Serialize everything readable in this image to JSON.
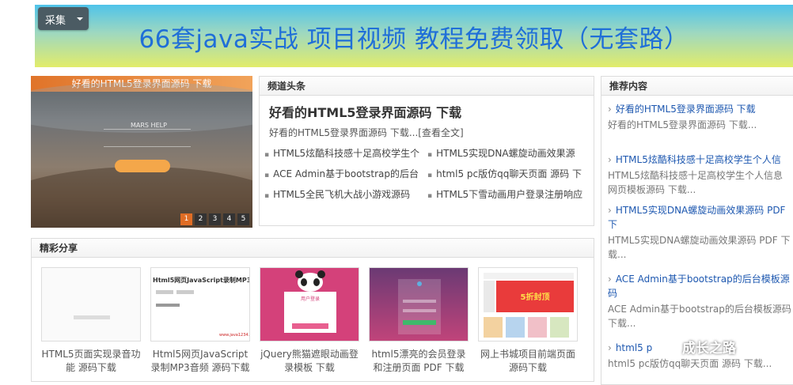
{
  "banner": {
    "title": "66套java实战 项目视频 教程免费领取（无套路）"
  },
  "collect": {
    "label": "采集"
  },
  "slider": {
    "title": "好看的HTML5登录界面源码 下载",
    "dots": [
      "1",
      "2",
      "3",
      "4",
      "5"
    ]
  },
  "channel": {
    "heading": "频道头条",
    "headline": "好看的HTML5登录界面源码 下载",
    "summary": "好看的HTML5登录界面源码 下载...",
    "more": "[查看全文]",
    "news": [
      "HTML5炫酷科技感十足高校学生个",
      "HTML5实现DNA螺旋动画效果源",
      "ACE Admin基于bootstrap的后台",
      "html5 pc版仿qq聊天页面 源码 下",
      "HTML5全民飞机大战小游戏源码",
      "HTML5下雪动画用户登录注册响应"
    ]
  },
  "share": {
    "heading": "精彩分享",
    "items": [
      {
        "caption": "HTML5页面实现录音功能 源码下载"
      },
      {
        "caption": "Html5网页JavaScript录制MP3音频 源码下载",
        "thumb_title": "Html5网页JavaScript录制MP3音频"
      },
      {
        "caption": "jQuery熊猫遮眼动画登录模板 下载",
        "thumb_title": "用户登录"
      },
      {
        "caption": "html5漂亮的会员登录和注册页面 PDF 下载"
      },
      {
        "caption": "网上书城项目前端页面 源码下载",
        "thumb_title": "5折封顶"
      }
    ]
  },
  "recommend": {
    "heading": "推荐内容",
    "items": [
      {
        "title": "好看的HTML5登录界面源码 下载",
        "desc": "好看的HTML5登录界面源码 下载..."
      },
      {
        "title": "HTML5炫酷科技感十足高校学生个人信",
        "desc": "HTML5炫酷科技感十足高校学生个人信息网页模板源码 下载..."
      },
      {
        "title": "HTML5实现DNA螺旋动画效果源码 PDF 下",
        "desc": "HTML5实现DNA螺旋动画效果源码 PDF 下载..."
      },
      {
        "title": "ACE Admin基于bootstrap的后台模板源码",
        "desc": "ACE Admin基于bootstrap的后台模板源码 下载..."
      },
      {
        "title": "html5 p",
        "desc": "html5 pc版仿qq聊天页面 源码 下载..."
      }
    ]
  },
  "watermark": {
    "text": "成长之路"
  },
  "colors": {
    "accent": "#1e58b0",
    "banner_text": "#1f6fd8",
    "slider_active": "#e06d25"
  }
}
